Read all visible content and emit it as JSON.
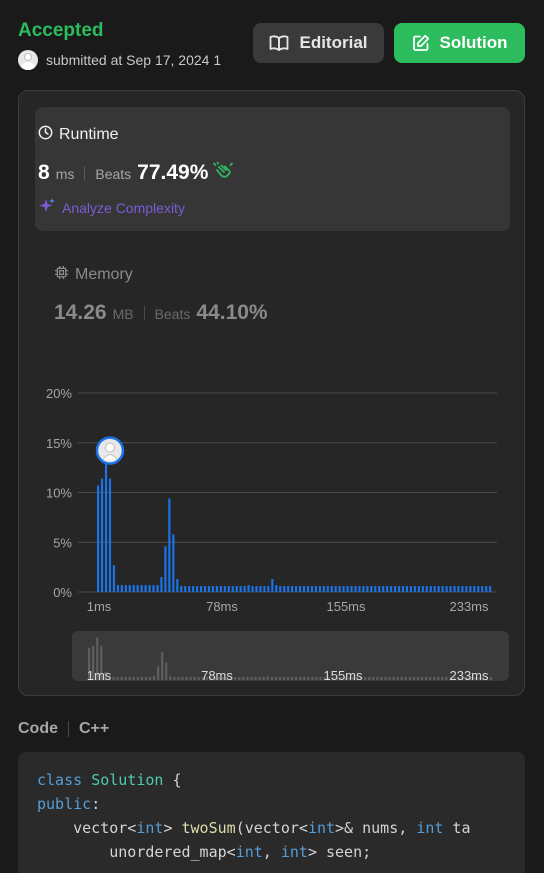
{
  "header": {
    "status": "Accepted",
    "submitted_text": "submitted at Sep 17, 2024 1",
    "editorial_label": "Editorial",
    "solution_label": "Solution"
  },
  "runtime": {
    "title": "Runtime",
    "value": "8",
    "unit": "ms",
    "beats_label": "Beats",
    "beats_value": "77.49%",
    "analyze_label": "Analyze Complexity"
  },
  "memory": {
    "title": "Memory",
    "value": "14.26",
    "unit": "MB",
    "beats_label": "Beats",
    "beats_value": "44.10%"
  },
  "code": {
    "label": "Code",
    "language": "C++"
  },
  "colors": {
    "accent_green": "#2cbb5d",
    "bar_blue": "#1a73e8",
    "analyze_purple": "#7c5cd6"
  },
  "chart_data": {
    "type": "bar",
    "ylabel": "",
    "xlabel": "",
    "ylim": [
      0,
      20
    ],
    "yticks": [
      "0%",
      "5%",
      "10%",
      "15%",
      "20%"
    ],
    "xtick_labels": [
      "1ms",
      "78ms",
      "155ms",
      "233ms"
    ],
    "grid": true,
    "user_bar_index": 3,
    "values": [
      10.7,
      11.4,
      14.2,
      11.4,
      2.7,
      0.7,
      0.7,
      0.7,
      0.7,
      0.7,
      0.7,
      0.7,
      0.7,
      0.7,
      0.7,
      0.7,
      1.5,
      4.6,
      9.4,
      5.8,
      1.3,
      0.6,
      0.6,
      0.6,
      0.6,
      0.6,
      0.6,
      0.6,
      0.6,
      0.6,
      0.6,
      0.6,
      0.6,
      0.6,
      0.6,
      0.6,
      0.6,
      0.6,
      0.7,
      0.6,
      0.6,
      0.6,
      0.6,
      0.6,
      1.3,
      0.7,
      0.6,
      0.6,
      0.6,
      0.6,
      0.6,
      0.6,
      0.6,
      0.6,
      0.6,
      0.6,
      0.6,
      0.6,
      0.6,
      0.6,
      0.6,
      0.6,
      0.6,
      0.6,
      0.6,
      0.6,
      0.6,
      0.6,
      0.6,
      0.6,
      0.6,
      0.6,
      0.6,
      0.6,
      0.6,
      0.6,
      0.6,
      0.6,
      0.6,
      0.6,
      0.6,
      0.6,
      0.6,
      0.6,
      0.6,
      0.6,
      0.6,
      0.6,
      0.6,
      0.6,
      0.6,
      0.6,
      0.6,
      0.6,
      0.6,
      0.6,
      0.6,
      0.6,
      0.6,
      0.6
    ],
    "minimap_xtick_labels": [
      "1ms",
      "78ms",
      "155ms",
      "233ms"
    ]
  },
  "code_lines": [
    [
      {
        "t": "class",
        "c": "kw"
      },
      {
        "t": " "
      },
      {
        "t": "Solution",
        "c": "ty"
      },
      {
        "t": " {"
      }
    ],
    [
      {
        "t": "public",
        "c": "kw"
      },
      {
        "t": ":"
      }
    ],
    [
      {
        "t": "    vector<"
      },
      {
        "t": "int",
        "c": "kw"
      },
      {
        "t": "> "
      },
      {
        "t": "twoSum",
        "c": "fn"
      },
      {
        "t": "(vector<"
      },
      {
        "t": "int",
        "c": "kw"
      },
      {
        "t": ">& nums, "
      },
      {
        "t": "int",
        "c": "kw"
      },
      {
        "t": " ta"
      }
    ],
    [
      {
        "t": "        unordered_map<"
      },
      {
        "t": "int",
        "c": "kw"
      },
      {
        "t": ", "
      },
      {
        "t": "int",
        "c": "kw"
      },
      {
        "t": "> seen;"
      }
    ]
  ]
}
